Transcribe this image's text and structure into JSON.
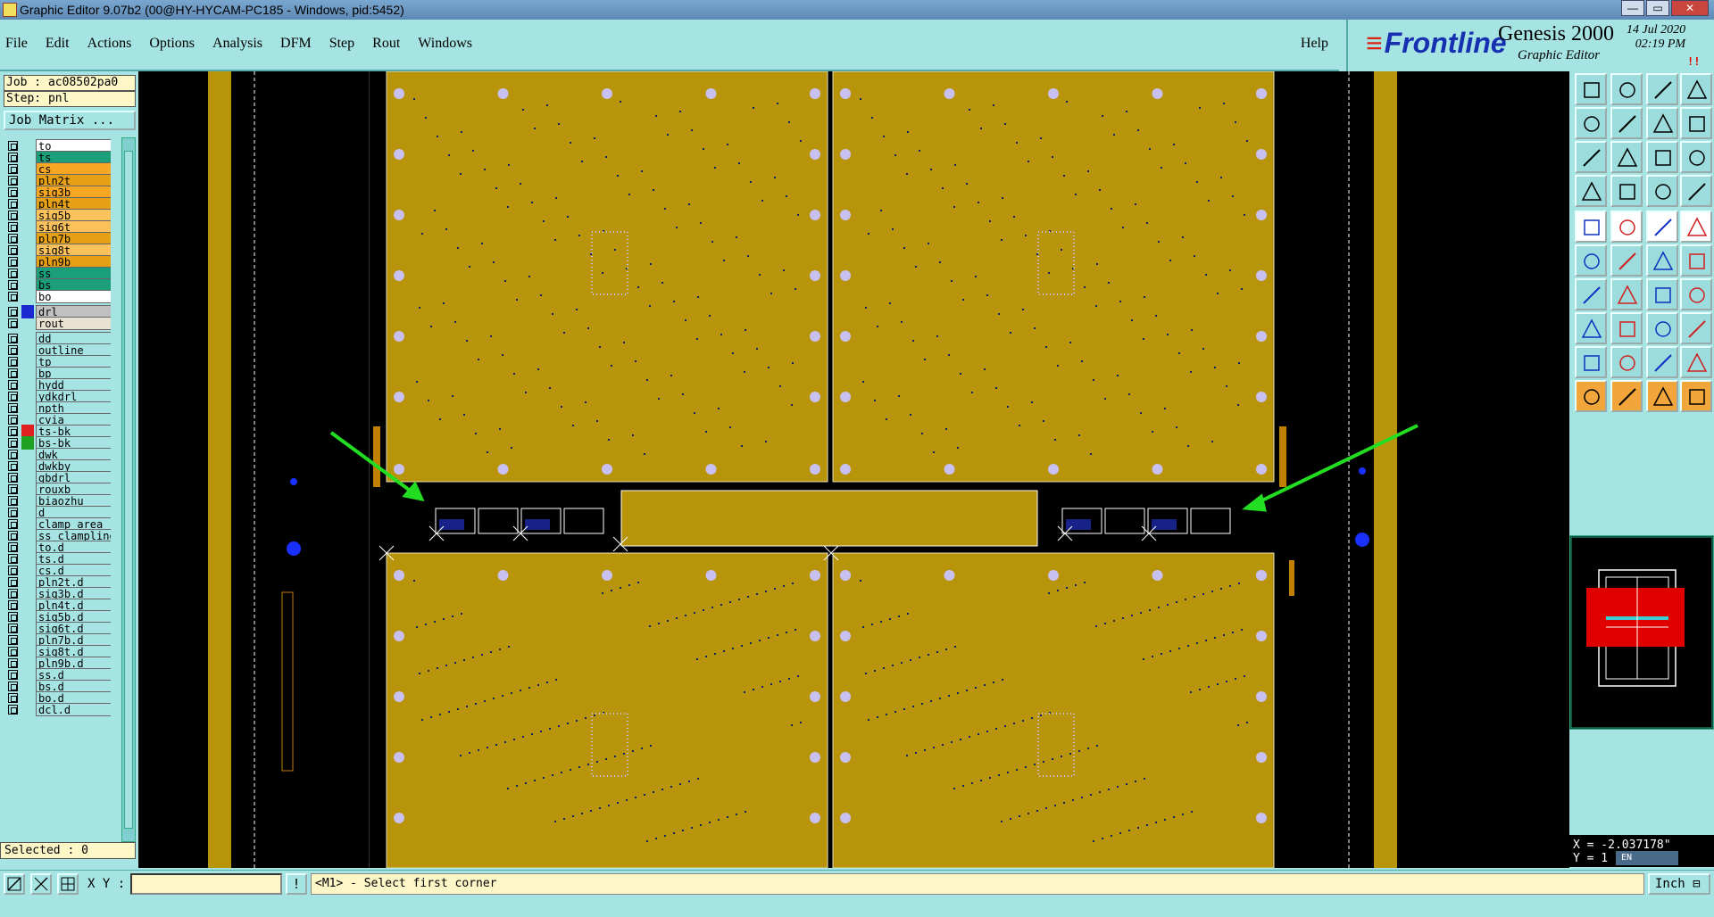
{
  "window": {
    "title": "Graphic Editor 9.07b2 (00@HY-HYCAM-PC185 - Windows, pid:5452)",
    "controls": [
      "—",
      "▭",
      "✕"
    ]
  },
  "menu": {
    "items": [
      "File",
      "Edit",
      "Actions",
      "Options",
      "Analysis",
      "DFM",
      "Step",
      "Rout",
      "Windows"
    ],
    "help": "Help"
  },
  "brand": {
    "logo": "Frontline",
    "product": "Genesis 2000",
    "subtitle": "Graphic Editor",
    "date": "14 Jul 2020",
    "time": "02:19 PM",
    "indicator": "!!"
  },
  "job": {
    "job_label": "Job : ac08502pa0",
    "step_label": "Step: pnl",
    "matrix_button": "Job Matrix ..."
  },
  "layers": [
    {
      "name": "to",
      "color": "#ffffff",
      "swatch": ""
    },
    {
      "name": "ts",
      "color": "#1a9f7a",
      "swatch": ""
    },
    {
      "name": "cs",
      "color": "#f5a623",
      "swatch": ""
    },
    {
      "name": "pln2t",
      "color": "#e6a015",
      "swatch": ""
    },
    {
      "name": "sig3b",
      "color": "#f5a623",
      "swatch": ""
    },
    {
      "name": "pln4t",
      "color": "#e6a015",
      "swatch": ""
    },
    {
      "name": "sig5b",
      "color": "#fbc25b",
      "swatch": ""
    },
    {
      "name": "sig6t",
      "color": "#fbc25b",
      "swatch": ""
    },
    {
      "name": "pln7b",
      "color": "#e6a015",
      "swatch": ""
    },
    {
      "name": "sig8t",
      "color": "#fbc25b",
      "swatch": ""
    },
    {
      "name": "pln9b",
      "color": "#e6a015",
      "swatch": ""
    },
    {
      "name": "ss",
      "color": "#1a9f7a",
      "swatch": ""
    },
    {
      "name": "bs",
      "color": "#1a9f7a",
      "swatch": ""
    },
    {
      "name": "bo",
      "color": "#ffffff",
      "swatch": ""
    },
    {
      "name": "drl",
      "color": "#c0c0c0",
      "swatch": "#1a2ad0",
      "gap": true
    },
    {
      "name": "rout",
      "color": "#e8e0d0",
      "swatch": ""
    },
    {
      "name": "dd",
      "color": "#a6e3e3",
      "swatch": "",
      "gap": true
    },
    {
      "name": "outline",
      "color": "#a6e3e3",
      "swatch": ""
    },
    {
      "name": "tp",
      "color": "#a6e3e3",
      "swatch": ""
    },
    {
      "name": "bp",
      "color": "#a6e3e3",
      "swatch": ""
    },
    {
      "name": "hydd",
      "color": "#a6e3e3",
      "swatch": ""
    },
    {
      "name": "ydkdrl",
      "color": "#a6e3e3",
      "swatch": ""
    },
    {
      "name": "npth",
      "color": "#a6e3e3",
      "swatch": ""
    },
    {
      "name": "cvia",
      "color": "#a6e3e3",
      "swatch": ""
    },
    {
      "name": "ts-bk",
      "color": "#a6e3e3",
      "swatch": "#e02020"
    },
    {
      "name": "bs-bk",
      "color": "#a6e3e3",
      "swatch": "#20a020"
    },
    {
      "name": "dwk",
      "color": "#a6e3e3",
      "swatch": ""
    },
    {
      "name": "dwkby",
      "color": "#a6e3e3",
      "swatch": ""
    },
    {
      "name": "gbdrl",
      "color": "#a6e3e3",
      "swatch": ""
    },
    {
      "name": "rouxb",
      "color": "#a6e3e3",
      "swatch": ""
    },
    {
      "name": "biaozhu",
      "color": "#a6e3e3",
      "swatch": ""
    },
    {
      "name": "d",
      "color": "#a6e3e3",
      "swatch": ""
    },
    {
      "name": "clamp_area",
      "color": "#a6e3e3",
      "swatch": ""
    },
    {
      "name": "ss_clampline",
      "color": "#a6e3e3",
      "swatch": ""
    },
    {
      "name": "to.d",
      "color": "#a6e3e3",
      "swatch": ""
    },
    {
      "name": "ts.d",
      "color": "#a6e3e3",
      "swatch": ""
    },
    {
      "name": "cs.d",
      "color": "#a6e3e3",
      "swatch": ""
    },
    {
      "name": "pln2t.d",
      "color": "#a6e3e3",
      "swatch": ""
    },
    {
      "name": "sig3b.d",
      "color": "#a6e3e3",
      "swatch": ""
    },
    {
      "name": "pln4t.d",
      "color": "#a6e3e3",
      "swatch": ""
    },
    {
      "name": "sig5b.d",
      "color": "#a6e3e3",
      "swatch": ""
    },
    {
      "name": "sig6t.d",
      "color": "#a6e3e3",
      "swatch": ""
    },
    {
      "name": "pln7b.d",
      "color": "#a6e3e3",
      "swatch": ""
    },
    {
      "name": "sig8t.d",
      "color": "#a6e3e3",
      "swatch": ""
    },
    {
      "name": "pln9b.d",
      "color": "#a6e3e3",
      "swatch": ""
    },
    {
      "name": "ss.d",
      "color": "#a6e3e3",
      "swatch": ""
    },
    {
      "name": "bs.d",
      "color": "#a6e3e3",
      "swatch": ""
    },
    {
      "name": "bo.d",
      "color": "#a6e3e3",
      "swatch": ""
    },
    {
      "name": "dcl.d",
      "color": "#a6e3e3",
      "swatch": ""
    }
  ],
  "selected_label": "Selected : 0",
  "status": {
    "xy_label": "X Y :",
    "xy_value": "",
    "bang": "!",
    "prompt": "<M1> - Select first corner",
    "unit": "Inch"
  },
  "coords": {
    "x_label": "X = -2.037178\"",
    "y_label": "Y = 1"
  },
  "tray": "EN",
  "colors": {
    "board": "#b8940a",
    "panel_bg": "#a6e3e3",
    "canvas_bg": "#000000",
    "arrow": "#22dd22",
    "pad": "#c8c0f0"
  },
  "toolbar_icons": [
    "zoom-home-icon",
    "zoom-in-icon",
    "home-icon",
    "panel-icon",
    "zoom-left-icon",
    "zoom-right-icon",
    "pan-icon",
    "step-icon",
    "fit-icon",
    "center-icon",
    "ratio-icon",
    "query-icon",
    "measure-icon",
    "grid-icon",
    "snap-icon",
    "snap-color-icon",
    "pad-icon",
    "line-icon",
    "ruler-icon",
    "circle-icon",
    "node-icon",
    "cross-icon",
    "move-icon",
    "rotate-icon",
    "angle-icon",
    "slope-icon",
    "arc-icon",
    "mirror-icon",
    "copy-icon",
    "flip-icon",
    "scale-icon",
    "array-icon",
    "tri-icon",
    "tri2-icon",
    "tri3-icon",
    "tri4-icon",
    "pointer-icon",
    "pointer2-icon",
    "pointer3-icon",
    "select-icon"
  ]
}
